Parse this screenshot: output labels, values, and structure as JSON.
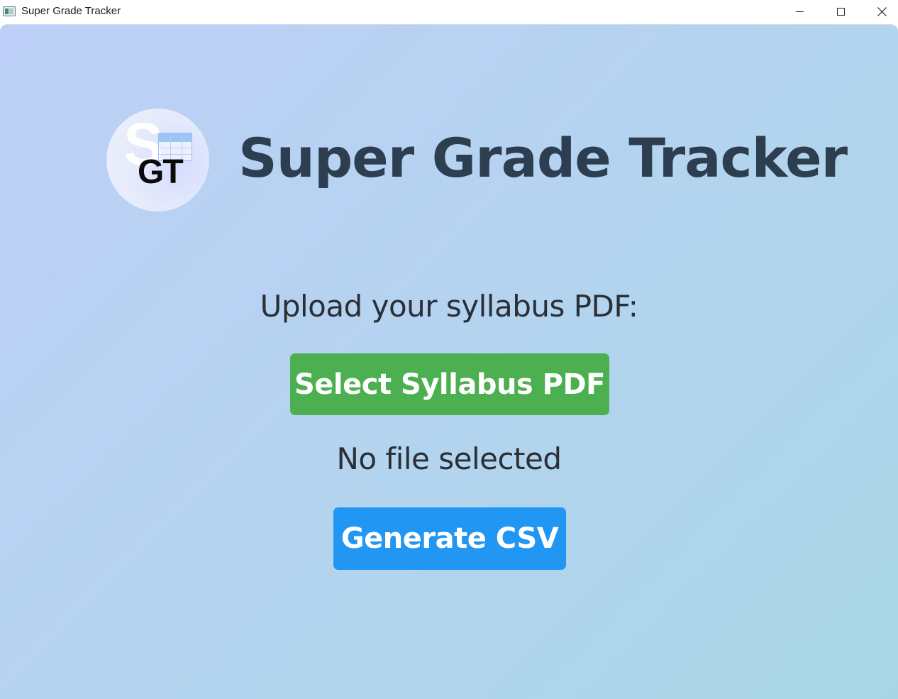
{
  "window": {
    "title": "Super Grade Tracker",
    "controls": [
      "minimize-icon",
      "maximize-icon",
      "close-icon"
    ]
  },
  "header": {
    "logo": {
      "letter": "S",
      "initials": "GT"
    },
    "title": "Super Grade Tracker"
  },
  "main": {
    "upload_label": "Upload your syllabus PDF:",
    "select_button_label": "Select Syllabus PDF",
    "file_status": "No file selected",
    "generate_button_label": "Generate CSV"
  },
  "colors": {
    "title_text": "#2c3e50",
    "select_button": "#4caf50",
    "generate_button": "#2196f3",
    "background_start": "#bdcff6",
    "background_end": "#a9d6e6"
  }
}
